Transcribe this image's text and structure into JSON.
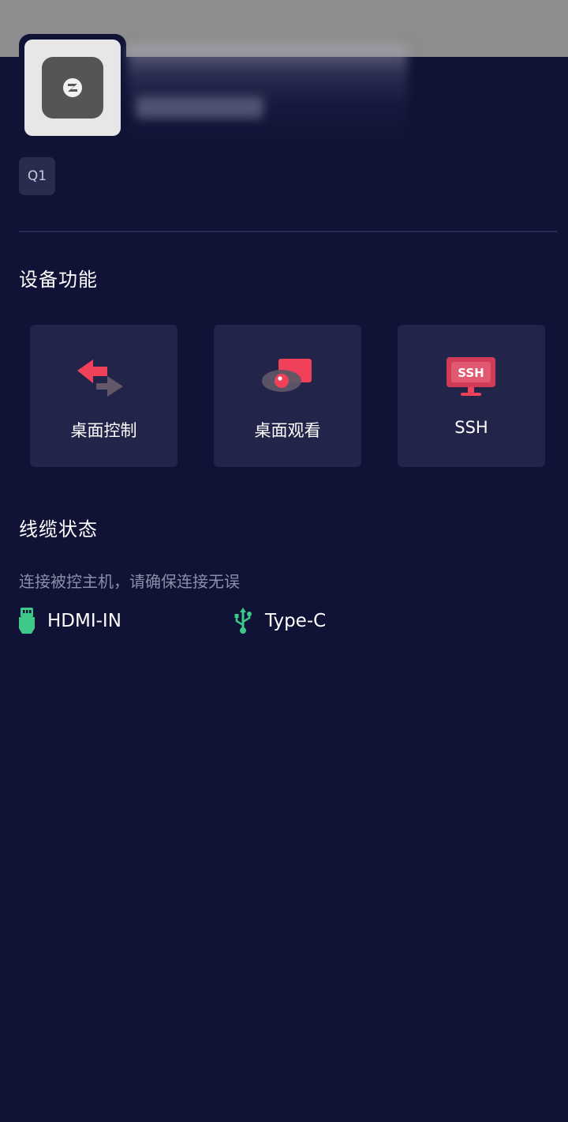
{
  "device": {
    "model": "Q1"
  },
  "sections": {
    "functions_title": "设备功能",
    "cable_title": "线缆状态"
  },
  "functions": [
    {
      "label": "桌面控制",
      "icon": "desktop-control-icon"
    },
    {
      "label": "桌面观看",
      "icon": "desktop-view-icon"
    },
    {
      "label": "SSH",
      "icon": "ssh-icon",
      "icon_text": "SSH"
    }
  ],
  "cable": {
    "hint": "连接被控主机，请确保连接无误",
    "items": [
      {
        "label": "HDMI-IN",
        "icon": "hdmi-plug-icon",
        "color": "#3ec98a"
      },
      {
        "label": "Type-C",
        "icon": "usb-icon",
        "color": "#3ec98a"
      }
    ]
  },
  "colors": {
    "background": "#111336",
    "card": "#22244a",
    "accent": "#f0405a",
    "status_ok": "#3ec98a"
  }
}
